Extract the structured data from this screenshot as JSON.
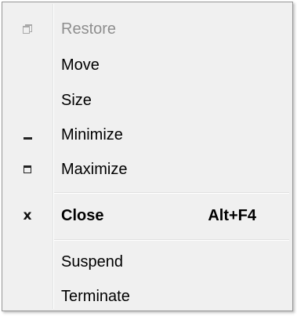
{
  "menu": {
    "items": [
      {
        "label": "Restore",
        "icon": "restore-icon",
        "disabled": true
      },
      {
        "label": "Move"
      },
      {
        "label": "Size"
      },
      {
        "label": "Minimize",
        "icon": "minimize-icon"
      },
      {
        "label": "Maximize",
        "icon": "maximize-icon"
      },
      {
        "label": "Close",
        "icon": "close-icon",
        "shortcut": "Alt+F4",
        "bold": true
      },
      {
        "label": "Suspend"
      },
      {
        "label": "Terminate"
      }
    ],
    "close_glyph": "x"
  }
}
